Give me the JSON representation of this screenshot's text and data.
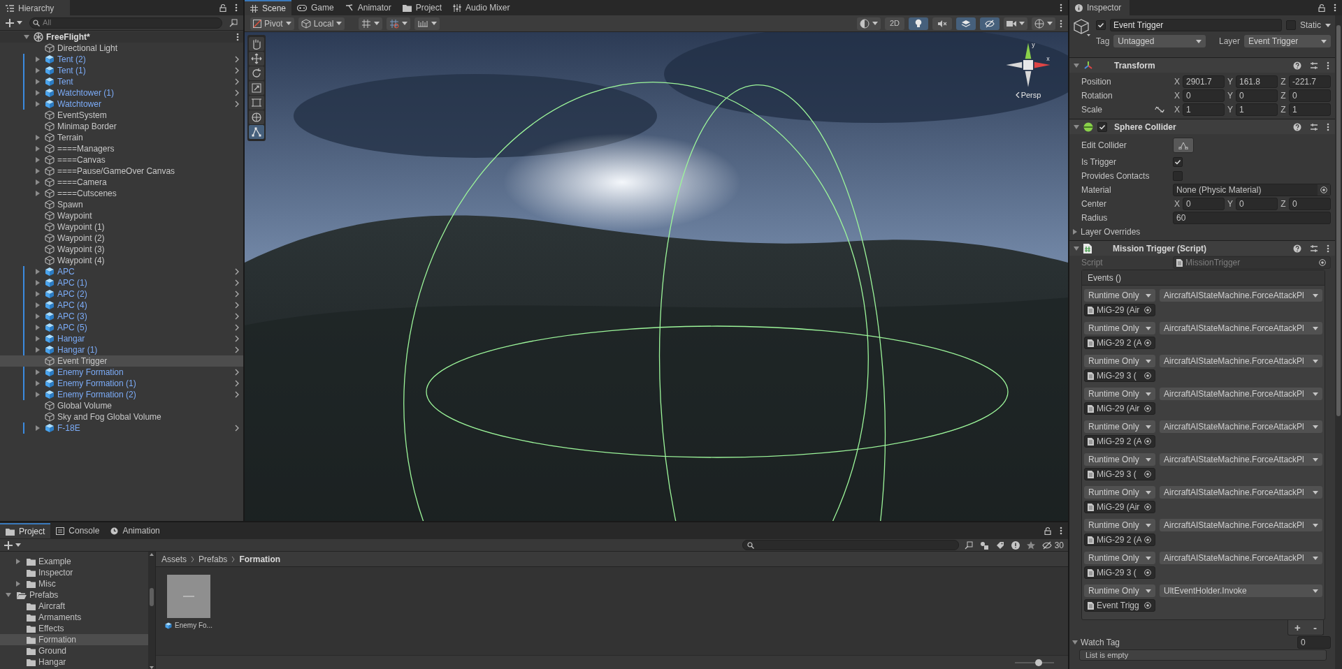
{
  "hierarchy": {
    "title": "Hierarchy",
    "search": {
      "placeholder": "All"
    },
    "scene": {
      "name": "FreeFlight*",
      "expanded": true
    },
    "items": [
      {
        "name": "Directional Light",
        "prefab": false,
        "expandable": false,
        "selected": false
      },
      {
        "name": "Tent (2)",
        "prefab": true,
        "expandable": true,
        "selected": false
      },
      {
        "name": "Tent (1)",
        "prefab": true,
        "expandable": true,
        "selected": false
      },
      {
        "name": "Tent",
        "prefab": true,
        "expandable": true,
        "selected": false
      },
      {
        "name": "Watchtower (1)",
        "prefab": true,
        "expandable": true,
        "selected": false
      },
      {
        "name": "Watchtower",
        "prefab": true,
        "expandable": true,
        "selected": false
      },
      {
        "name": "EventSystem",
        "prefab": false,
        "expandable": false,
        "selected": false
      },
      {
        "name": "Minimap Border",
        "prefab": false,
        "expandable": false,
        "selected": false
      },
      {
        "name": "Terrain",
        "prefab": false,
        "expandable": true,
        "selected": false
      },
      {
        "name": "====Managers",
        "prefab": false,
        "expandable": true,
        "selected": false
      },
      {
        "name": "====Canvas",
        "prefab": false,
        "expandable": true,
        "selected": false
      },
      {
        "name": "====Pause/GameOver Canvas",
        "prefab": false,
        "expandable": true,
        "selected": false
      },
      {
        "name": "====Camera",
        "prefab": false,
        "expandable": true,
        "selected": false
      },
      {
        "name": "====Cutscenes",
        "prefab": false,
        "expandable": true,
        "selected": false
      },
      {
        "name": "Spawn",
        "prefab": false,
        "expandable": false,
        "selected": false
      },
      {
        "name": "Waypoint",
        "prefab": false,
        "expandable": false,
        "selected": false
      },
      {
        "name": "Waypoint (1)",
        "prefab": false,
        "expandable": false,
        "selected": false
      },
      {
        "name": "Waypoint (2)",
        "prefab": false,
        "expandable": false,
        "selected": false
      },
      {
        "name": "Waypoint (3)",
        "prefab": false,
        "expandable": false,
        "selected": false
      },
      {
        "name": "Waypoint (4)",
        "prefab": false,
        "expandable": false,
        "selected": false
      },
      {
        "name": "APC",
        "prefab": true,
        "expandable": true,
        "selected": false
      },
      {
        "name": "APC (1)",
        "prefab": true,
        "expandable": true,
        "selected": false
      },
      {
        "name": "APC (2)",
        "prefab": true,
        "expandable": true,
        "selected": false
      },
      {
        "name": "APC (4)",
        "prefab": true,
        "expandable": true,
        "selected": false
      },
      {
        "name": "APC (3)",
        "prefab": true,
        "expandable": true,
        "selected": false
      },
      {
        "name": "APC (5)",
        "prefab": true,
        "expandable": true,
        "selected": false
      },
      {
        "name": "Hangar",
        "prefab": true,
        "expandable": true,
        "selected": false
      },
      {
        "name": "Hangar (1)",
        "prefab": true,
        "expandable": true,
        "selected": false
      },
      {
        "name": "Event Trigger",
        "prefab": false,
        "expandable": false,
        "selected": true
      },
      {
        "name": "Enemy Formation",
        "prefab": true,
        "expandable": true,
        "selected": false
      },
      {
        "name": "Enemy Formation (1)",
        "prefab": true,
        "expandable": true,
        "selected": false
      },
      {
        "name": "Enemy Formation (2)",
        "prefab": true,
        "expandable": true,
        "selected": false
      },
      {
        "name": "Global Volume",
        "prefab": false,
        "expandable": false,
        "selected": false
      },
      {
        "name": "Sky and Fog Global Volume",
        "prefab": false,
        "expandable": false,
        "selected": false
      },
      {
        "name": "F-18E",
        "prefab": true,
        "expandable": true,
        "selected": false
      }
    ]
  },
  "scene_tabs": [
    {
      "kind": "scene",
      "label": "Scene",
      "selected": true
    },
    {
      "kind": "game",
      "label": "Game",
      "selected": false
    },
    {
      "kind": "animator",
      "label": "Animator",
      "selected": false
    },
    {
      "kind": "project",
      "label": "Project",
      "selected": false
    },
    {
      "kind": "mixer",
      "label": "Audio Mixer",
      "selected": false
    }
  ],
  "scene_toolbar": {
    "pivot": "Pivot",
    "space": "Local",
    "toggles": [
      {
        "kind": "dimension",
        "label": "2D",
        "on": false
      },
      {
        "kind": "lighting",
        "on": true
      },
      {
        "kind": "audio",
        "on": false
      },
      {
        "kind": "effects",
        "on": true
      },
      {
        "kind": "visibility",
        "on": true
      }
    ]
  },
  "scene_view": {
    "projection": "Persp",
    "axes": [
      "y",
      "x"
    ],
    "tools": [
      {
        "kind": "hand",
        "selected": false
      },
      {
        "kind": "move",
        "selected": false
      },
      {
        "kind": "rotate",
        "selected": false
      },
      {
        "kind": "scale",
        "selected": false
      },
      {
        "kind": "rect",
        "selected": false
      },
      {
        "kind": "transform",
        "selected": false
      },
      {
        "kind": "collider",
        "selected": true
      }
    ]
  },
  "inspector": {
    "title": "Inspector",
    "object": {
      "active": true,
      "name": "Event Trigger",
      "static": false,
      "static_label": "Static",
      "tag_label": "Tag",
      "tag": "Untagged",
      "layer_label": "Layer",
      "layer": "Event Trigger"
    },
    "transform": {
      "title": "Transform",
      "rows": [
        {
          "label": "Position",
          "values": [
            {
              "axis": "X",
              "value": "2901.7"
            },
            {
              "axis": "Y",
              "value": "161.8"
            },
            {
              "axis": "Z",
              "value": "-221.7"
            }
          ]
        },
        {
          "label": "Rotation",
          "values": [
            {
              "axis": "X",
              "value": "0"
            },
            {
              "axis": "Y",
              "value": "0"
            },
            {
              "axis": "Z",
              "value": "0"
            }
          ]
        },
        {
          "label": "Scale",
          "constrained": false,
          "values": [
            {
              "axis": "X",
              "value": "1"
            },
            {
              "axis": "Y",
              "value": "1"
            },
            {
              "axis": "Z",
              "value": "1"
            }
          ]
        }
      ]
    },
    "sphere_collider": {
      "title": "Sphere Collider",
      "enabled": true,
      "fields": [
        {
          "kind": "edit",
          "label": "Edit Collider"
        },
        {
          "kind": "checkbox",
          "label": "Is Trigger",
          "checked": true
        },
        {
          "kind": "checkbox",
          "label": "Provides Contacts",
          "checked": false
        },
        {
          "kind": "object",
          "label": "Material",
          "value": "None (Physic Material)"
        },
        {
          "kind": "vector",
          "label": "Center",
          "values": [
            {
              "axis": "X",
              "value": "0"
            },
            {
              "axis": "Y",
              "value": "0"
            },
            {
              "axis": "Z",
              "value": "0"
            }
          ]
        },
        {
          "kind": "text",
          "label": "Radius",
          "value": "60"
        }
      ],
      "foldout": {
        "label": "Layer Overrides",
        "expanded": false
      }
    },
    "script": {
      "title": "Mission Trigger (Script)",
      "script_label": "Script",
      "script_value": "MissionTrigger",
      "events_title": "Events ()",
      "events": [
        {
          "mode": "Runtime Only",
          "function": "AircraftAIStateMachine.ForceAttackPl",
          "target": "MiG-29  (Air"
        },
        {
          "mode": "Runtime Only",
          "function": "AircraftAIStateMachine.ForceAttackPl",
          "target": "MiG-29 2 (A"
        },
        {
          "mode": "Runtime Only",
          "function": "AircraftAIStateMachine.ForceAttackPl",
          "target": "MiG-29  3 ("
        },
        {
          "mode": "Runtime Only",
          "function": "AircraftAIStateMachine.ForceAttackPl",
          "target": "MiG-29  (Air"
        },
        {
          "mode": "Runtime Only",
          "function": "AircraftAIStateMachine.ForceAttackPl",
          "target": "MiG-29 2 (A"
        },
        {
          "mode": "Runtime Only",
          "function": "AircraftAIStateMachine.ForceAttackPl",
          "target": "MiG-29  3 ("
        },
        {
          "mode": "Runtime Only",
          "function": "AircraftAIStateMachine.ForceAttackPl",
          "target": "MiG-29  (Air"
        },
        {
          "mode": "Runtime Only",
          "function": "AircraftAIStateMachine.ForceAttackPl",
          "target": "MiG-29 2 (A"
        },
        {
          "mode": "Runtime Only",
          "function": "AircraftAIStateMachine.ForceAttackPl",
          "target": "MiG-29  3 ("
        },
        {
          "mode": "Runtime Only",
          "function": "UltEventHolder.Invoke",
          "target": "Event Trigg"
        }
      ],
      "add_label": "+",
      "remove_label": "-",
      "watch_tag": {
        "label": "Watch Tag",
        "value": "0",
        "expanded": true,
        "empty_text": "List is empty"
      }
    }
  },
  "project": {
    "tabs": [
      {
        "kind": "project",
        "label": "Project",
        "selected": true
      },
      {
        "kind": "console",
        "label": "Console",
        "selected": false
      },
      {
        "kind": "animation",
        "label": "Animation",
        "selected": false
      }
    ],
    "hidden_count": "30",
    "tree": [
      {
        "children": [
          {
            "name": "Example",
            "expanded": false,
            "selected": false
          },
          {
            "name": "Inspector",
            "selected": false
          },
          {
            "name": "Misc",
            "expanded": false,
            "selected": false
          }
        ]
      },
      {
        "name": "Prefabs",
        "expanded": true,
        "selected": false,
        "children": [
          {
            "name": "Aircraft",
            "selected": false
          },
          {
            "name": "Armaments",
            "selected": false
          },
          {
            "name": "Effects",
            "selected": false
          },
          {
            "name": "Formation",
            "selected": true
          },
          {
            "name": "Ground",
            "selected": false
          },
          {
            "name": "Hangar",
            "selected": false
          }
        ]
      }
    ],
    "breadcrumb": [
      "Assets",
      "Prefabs",
      "Formation"
    ],
    "assets": [
      {
        "name": "Enemy Fo...",
        "prefab": true
      }
    ],
    "thumbnail_size": {
      "level": 0.6
    }
  }
}
